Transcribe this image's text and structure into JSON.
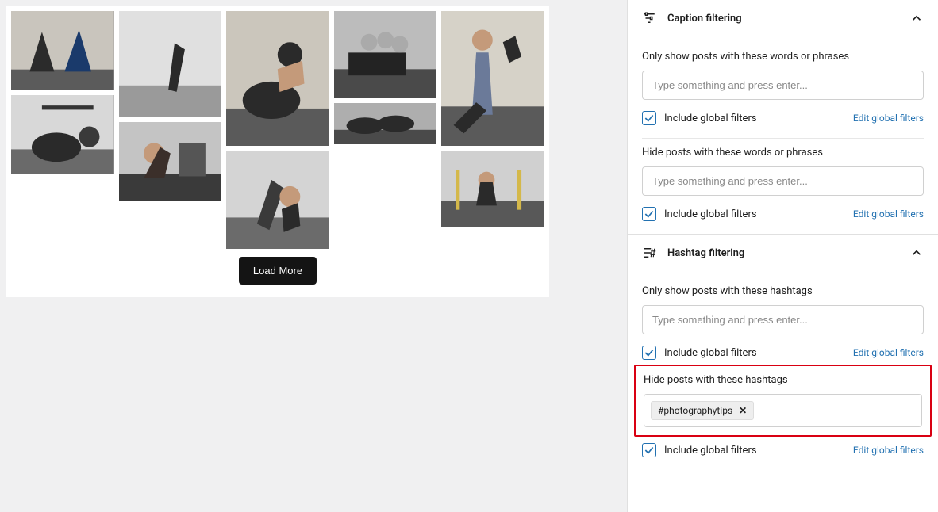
{
  "feed": {
    "load_more_label": "Load More"
  },
  "sidebar": {
    "caption_section": {
      "title": "Caption filtering",
      "show_label": "Only show posts with these words or phrases",
      "show_placeholder": "Type something and press enter...",
      "hide_label": "Hide posts with these words or phrases",
      "hide_placeholder": "Type something and press enter...",
      "include_global_label": "Include global filters",
      "edit_link": "Edit global filters"
    },
    "hashtag_section": {
      "title": "Hashtag filtering",
      "show_label": "Only show posts with these hashtags",
      "show_placeholder": "Type something and press enter...",
      "hide_label": "Hide posts with these hashtags",
      "include_global_label": "Include global filters",
      "edit_link": "Edit global filters",
      "hide_tag": "#photographytips"
    }
  }
}
